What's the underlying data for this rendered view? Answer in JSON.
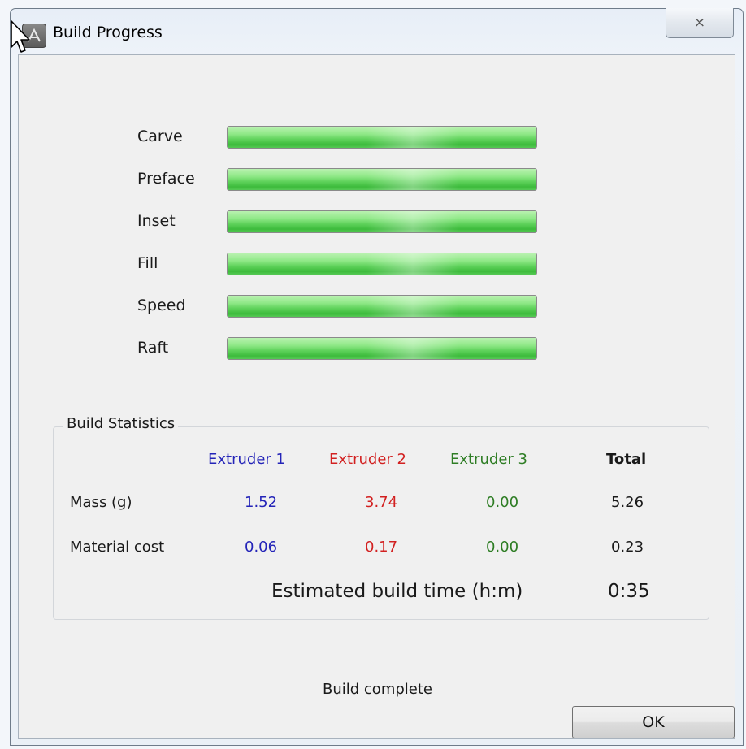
{
  "window": {
    "title": "Build Progress",
    "close_glyph": "⨯"
  },
  "progress": [
    {
      "label": "Carve",
      "value": 1.0
    },
    {
      "label": "Preface",
      "value": 1.0
    },
    {
      "label": "Inset",
      "value": 1.0
    },
    {
      "label": "Fill",
      "value": 1.0
    },
    {
      "label": "Speed",
      "value": 1.0
    },
    {
      "label": "Raft",
      "value": 1.0
    }
  ],
  "stats": {
    "group_label": "Build Statistics",
    "headers": {
      "ext1": "Extruder 1",
      "ext2": "Extruder 2",
      "ext3": "Extruder 3",
      "total": "Total"
    },
    "rows": [
      {
        "label": "Mass (g)",
        "ext1": "1.52",
        "ext2": "3.74",
        "ext3": "0.00",
        "total": "5.26"
      },
      {
        "label": "Material cost",
        "ext1": "0.06",
        "ext2": "0.17",
        "ext3": "0.00",
        "total": "0.23"
      }
    ],
    "estimated_label": "Estimated build time (h:m)",
    "estimated_value": "0:35"
  },
  "status_text": "Build complete",
  "ok_label": "OK",
  "colors": {
    "extruder1": "#2424b8",
    "extruder2": "#d22020",
    "extruder3": "#2e7d24",
    "bar_green": "#5fd25b"
  },
  "icons": {
    "app": "app-logo-icon",
    "close": "close-icon",
    "cursor": "mouse-pointer-icon"
  }
}
